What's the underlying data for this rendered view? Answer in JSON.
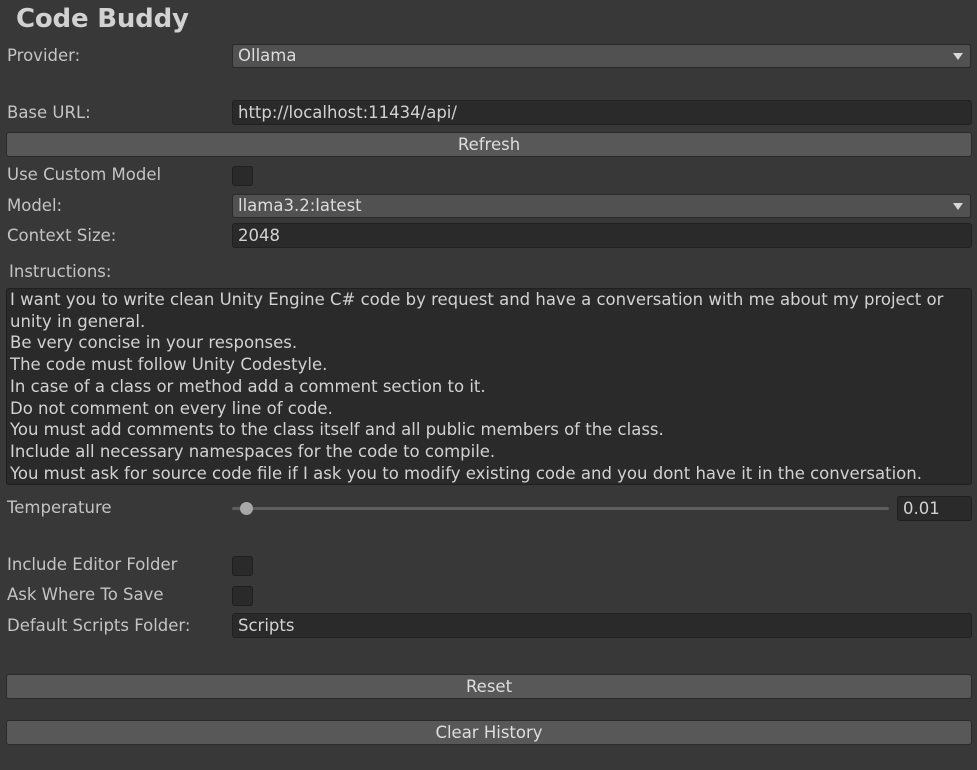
{
  "window": {
    "title": "Code Buddy"
  },
  "provider": {
    "label": "Provider:",
    "selected": "Ollama"
  },
  "base_url": {
    "label": "Base URL:",
    "value": "http://localhost:11434/api/"
  },
  "refresh_button": {
    "label": "Refresh"
  },
  "use_custom_model": {
    "label": "Use Custom Model",
    "checked": false
  },
  "model": {
    "label": "Model:",
    "selected": "llama3.2:latest"
  },
  "context_size": {
    "label": "Context Size:",
    "value": "2048"
  },
  "instructions": {
    "label": "Instructions:",
    "lines": [
      "I want you to write clean Unity Engine C# code by request and have a conversation with me about my project or",
      "unity in general.",
      "Be very concise in your responses.",
      "The code must follow Unity Codestyle.",
      "In case of a class or method add a comment section to it.",
      "Do not comment on every line of code.",
      "You must add comments to the class itself and all public members of the class.",
      "Include all necessary namespaces for the code to compile.",
      "You must ask for source code file if I ask you to modify existing code and you dont have it in the conversation."
    ]
  },
  "temperature": {
    "label": "Temperature",
    "value": "0.01",
    "fraction": 0.01
  },
  "include_editor_folder": {
    "label": "Include Editor Folder",
    "checked": false
  },
  "ask_where_to_save": {
    "label": "Ask Where To Save",
    "checked": false
  },
  "default_scripts_folder": {
    "label": "Default Scripts Folder:",
    "value": "Scripts"
  },
  "reset_button": {
    "label": "Reset"
  },
  "clear_history_button": {
    "label": "Clear History"
  },
  "icons": {
    "dropdown_arrow": "chevron-down-icon"
  }
}
